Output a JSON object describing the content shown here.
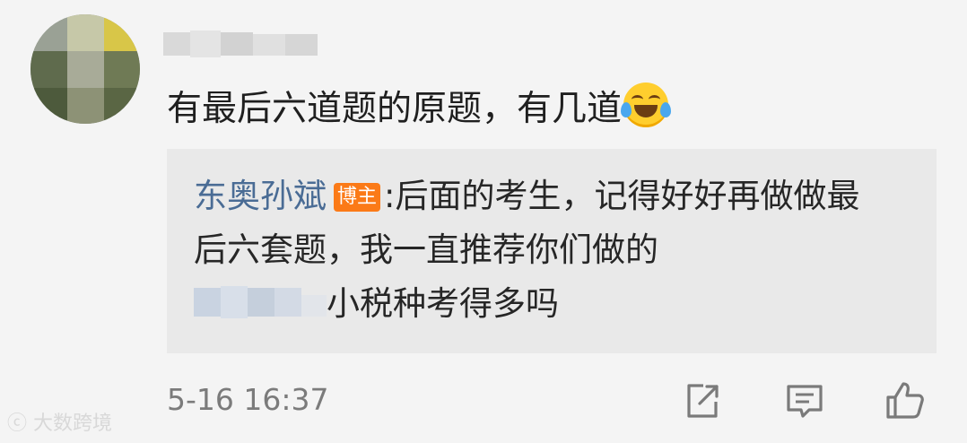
{
  "comment": {
    "username": "",
    "text": "有最后六道题的原题，有几道",
    "emoji": "laughing-tears-emoji"
  },
  "reply": {
    "author": "东奥孙斌",
    "badge": "博主",
    "line1": ":后面的考生，记得好好再做做最",
    "line2": "后六套题，我一直推荐你们做的",
    "line3_suffix": "小税种考得多吗"
  },
  "timestamp": "5-16 16:37",
  "actions": {
    "share": "share-icon",
    "comment": "comment-icon",
    "like": "thumbs-up-icon"
  },
  "watermark": "大数跨境",
  "colors": {
    "background": "#f4f4f4",
    "reply_background": "#e9e9e9",
    "author_link": "#4a6c95",
    "badge": "#fb7a17",
    "timestamp": "#7b7b7b",
    "icon": "#7a7a7a"
  }
}
